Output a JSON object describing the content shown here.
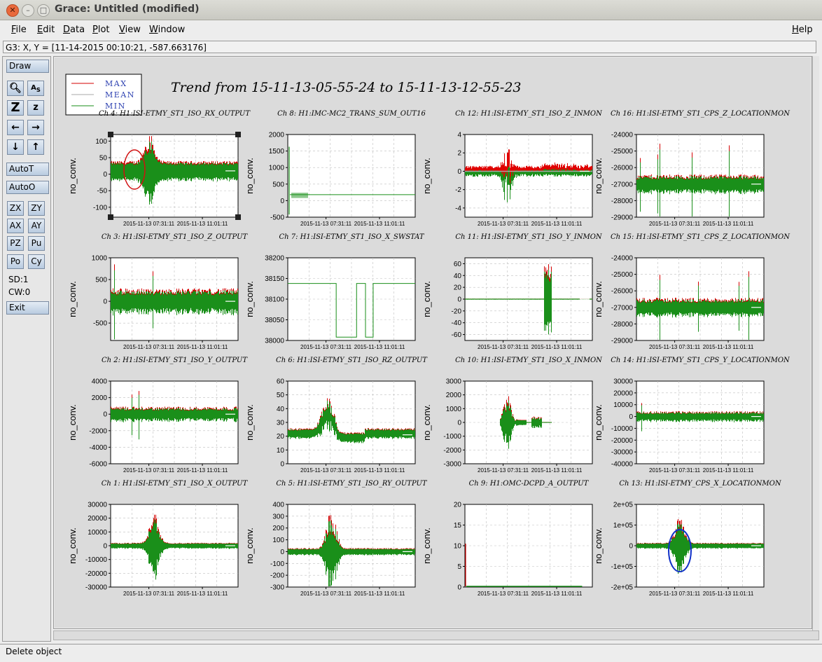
{
  "window": {
    "title": "Grace: Untitled (modified)"
  },
  "menubar": {
    "items": [
      "File",
      "Edit",
      "Data",
      "Plot",
      "View",
      "Window"
    ],
    "help": "Help"
  },
  "coord_readout": "G3: X, Y = [11-14-2015 00:10:21, -587.663176]",
  "toolbar": {
    "draw": "Draw",
    "autot": "AutoT",
    "autoo": "AutoO",
    "zoom_buttons": [
      "ZX",
      "ZY",
      "AX",
      "AY",
      "PZ",
      "Pu",
      "Po",
      "Cy"
    ],
    "sd": "SD:1",
    "cw": "CW:0",
    "exit": "Exit",
    "icons": [
      "magnifier-icon",
      "autoscale-text-icon",
      "zoom-z-big-icon",
      "zoom-z-small-icon",
      "arrow-left-icon",
      "arrow-right-icon",
      "arrow-down-icon",
      "arrow-up-icon"
    ]
  },
  "status": "Delete object",
  "chart_data": {
    "type": "line",
    "title": "Trend from 15-11-13-05-55-24 to 15-11-13-12-55-23",
    "legend": {
      "placement": "top-left",
      "entries": [
        {
          "name": "MAX",
          "color": "#d40000"
        },
        {
          "name": "MEAN",
          "color": "#a8a8a8"
        },
        {
          "name": "MIN",
          "color": "#1a8f1a"
        }
      ]
    },
    "xlabel_ticks": [
      "2015-11-13 07:31:11",
      "2015-11-13 11:01:11"
    ],
    "panels": [
      {
        "id": "ch4",
        "title": "Ch 4: H1:ISI-ETMY_ST1_ISO_RX_OUTPUT",
        "ylabel": "no_conv.",
        "yticks": [
          "100",
          "50",
          "0",
          "-50",
          "-100"
        ],
        "ylim": [
          -130,
          120
        ],
        "envelope": "burst-early",
        "base": 10,
        "amp": 25,
        "spike_max": 105,
        "spike_min": -125,
        "selected": true,
        "marker": "red-ellipse"
      },
      {
        "id": "ch8",
        "title": "Ch 8: H1:IMC-MC2_TRANS_SUM_OUT16",
        "ylabel": "no_conv.",
        "yticks": [
          "2000",
          "1500",
          "1000",
          "500",
          "0",
          "-500"
        ],
        "ylim": [
          -500,
          2000
        ],
        "envelope": "step-flat",
        "base": 180,
        "amp": 0,
        "spike_max": 1630,
        "spike_min": -420
      },
      {
        "id": "ch12",
        "title": "Ch 12: H1:ISI-ETMY_ST1_ISO_Z_INMON",
        "ylabel": "no_conv.",
        "yticks": [
          "4",
          "2",
          "0",
          "-2",
          "-4"
        ],
        "ylim": [
          -5,
          4
        ],
        "envelope": "asym-red",
        "base": 0,
        "amp": 0.4,
        "spike_max": 3.6,
        "spike_min": -4.4
      },
      {
        "id": "ch16",
        "title": "Ch 16: H1:ISI-ETMY_ST1_CPS_Z_LOCATIONMON",
        "ylabel": "no_conv.",
        "yticks": [
          "-24000",
          "-25000",
          "-26000",
          "-27000",
          "-28000",
          "-29000"
        ],
        "ylim": [
          -29000,
          -24000
        ],
        "envelope": "dense",
        "base": -27000,
        "amp": 450,
        "spike_max": -24300,
        "spike_min": -28800
      },
      {
        "id": "ch3",
        "title": "Ch 3: H1:ISI-ETMY_ST1_ISO_Z_OUTPUT",
        "ylabel": "no_conv.",
        "yticks": [
          "1000",
          "500",
          "0",
          "-500"
        ],
        "ylim": [
          -900,
          1000
        ],
        "envelope": "dense",
        "base": 0,
        "amp": 230,
        "spike_max": 900,
        "spike_min": -600
      },
      {
        "id": "ch7",
        "title": "Ch 7: H1:ISI-ETMY_ST1_ISO_X_SWSTAT",
        "ylabel": "no_conv.",
        "yticks": [
          "38200",
          "38150",
          "38100",
          "38050",
          "38000"
        ],
        "ylim": [
          38000,
          38200
        ],
        "envelope": "switch",
        "base": 38138,
        "amp": 0,
        "low": 38008
      },
      {
        "id": "ch11",
        "title": "Ch 11: H1:ISI-ETMY_ST1_ISO_Y_INMON",
        "ylabel": "no_conv.",
        "yticks": [
          "60",
          "40",
          "20",
          "0",
          "-20",
          "-40",
          "-60"
        ],
        "ylim": [
          -70,
          70
        ],
        "envelope": "late-burst",
        "base": 0,
        "amp": 0.8,
        "spike_max": 62,
        "spike_min": -62
      },
      {
        "id": "ch15",
        "title": "Ch 15: H1:ISI-ETMY_ST1_CPS_Z_LOCATIONMON",
        "ylabel": "no_conv.",
        "yticks": [
          "-24000",
          "-25000",
          "-26000",
          "-27000",
          "-28000",
          "-29000"
        ],
        "ylim": [
          -29000,
          -24000
        ],
        "envelope": "dense",
        "base": -27000,
        "amp": 450,
        "spike_max": -24400,
        "spike_min": -28700
      },
      {
        "id": "ch2",
        "title": "Ch 2: H1:ISI-ETMY_ST1_ISO_Y_OUTPUT",
        "ylabel": "no_conv.",
        "yticks": [
          "4000",
          "2000",
          "0",
          "-2000",
          "-4000",
          "-6000"
        ],
        "ylim": [
          -6000,
          4000
        ],
        "envelope": "dense",
        "base": 0,
        "amp": 700,
        "spike_max": 3000,
        "spike_min": -6000
      },
      {
        "id": "ch6",
        "title": "Ch 6: H1:ISI-ETMY_ST1_ISO_RZ_OUTPUT",
        "ylabel": "no_conv.",
        "yticks": [
          "60",
          "50",
          "40",
          "30",
          "20",
          "10",
          "0"
        ],
        "ylim": [
          0,
          60
        ],
        "envelope": "hump",
        "base": 22,
        "amp": 3,
        "spike_max": 54,
        "spike_min": 0
      },
      {
        "id": "ch10",
        "title": "Ch 10: H1:ISI-ETMY_ST1_ISO_X_INMON",
        "ylabel": "no_conv.",
        "yticks": [
          "3000",
          "2000",
          "1000",
          "0",
          "-1000",
          "-2000",
          "-3000"
        ],
        "ylim": [
          -3000,
          3000
        ],
        "envelope": "mid-burst",
        "base": 0,
        "amp": 30,
        "spike_max": 2100,
        "spike_min": -2100
      },
      {
        "id": "ch14",
        "title": "Ch 14: H1:ISI-ETMY_ST1_CPS_Y_LOCATIONMON",
        "ylabel": "no_conv.",
        "yticks": [
          "30000",
          "20000",
          "10000",
          "0",
          "-10000",
          "-20000",
          "-30000",
          "-40000"
        ],
        "ylim": [
          -40000,
          30000
        ],
        "envelope": "dense",
        "base": 0,
        "amp": 3500,
        "spike_max": 20000,
        "spike_min": -40000
      },
      {
        "id": "ch1",
        "title": "Ch 1: H1:ISI-ETMY_ST1_ISO_X_OUTPUT",
        "ylabel": "no_conv.",
        "yticks": [
          "30000",
          "20000",
          "10000",
          "0",
          "-10000",
          "-20000",
          "-30000"
        ],
        "ylim": [
          -30000,
          30000
        ],
        "envelope": "burst",
        "base": 0,
        "amp": 1800,
        "spike_max": 23000,
        "spike_min": -25000
      },
      {
        "id": "ch5",
        "title": "Ch 5: H1:ISI-ETMY_ST1_ISO_RY_OUTPUT",
        "ylabel": "no_conv.",
        "yticks": [
          "400",
          "300",
          "200",
          "100",
          "0",
          "-100",
          "-200",
          "-300"
        ],
        "ylim": [
          -300,
          400
        ],
        "envelope": "burst",
        "base": 0,
        "amp": 25,
        "spike_max": 350,
        "spike_min": -290
      },
      {
        "id": "ch9",
        "title": "Ch 9: H1:OMC-DCPD_A_OUTPUT",
        "ylabel": "no_conv.",
        "yticks": [
          "20",
          "15",
          "10",
          "5",
          "0"
        ],
        "ylim": [
          0,
          20
        ],
        "envelope": "flat-zero",
        "base": 0.1,
        "amp": 0,
        "spike_max": 10.5,
        "spike_min": 0
      },
      {
        "id": "ch13",
        "title": "Ch 13: H1:ISI-ETMY_CPS_X_LOCATIONMON",
        "ylabel": "no_conv.",
        "yticks": [
          "2e+05",
          "1e+05",
          "0",
          "-1e+05",
          "-2e+05"
        ],
        "ylim": [
          -200000,
          200000
        ],
        "envelope": "burst",
        "base": 0,
        "amp": 12000,
        "spike_max": 160000,
        "spike_min": -150000,
        "marker": "blue-ellipse"
      }
    ]
  }
}
